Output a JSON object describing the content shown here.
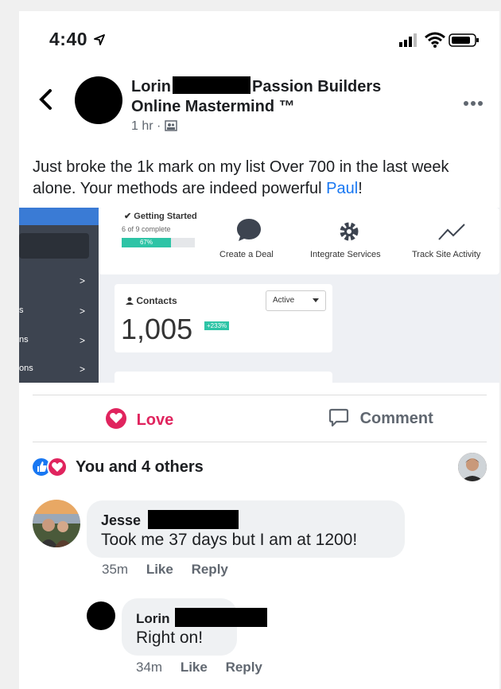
{
  "status": {
    "time": "4:40"
  },
  "post": {
    "author_first": "Lorin",
    "author_rest": "Passion Builders",
    "author_line2": "Online Mastermind ™",
    "time_ago": "1 hr",
    "text_before": "Just broke the 1k mark on my list Over 700 in the last week alone. Your methods are indeed powerful ",
    "text_link": "Paul",
    "text_after": "!"
  },
  "screenshot": {
    "getting_started": "✔ Getting Started",
    "progress_text": "6 of 9 complete",
    "progress_pct": "67%",
    "progress_value": 0.67,
    "actions": [
      "Create a Deal",
      "Integrate Services",
      "Track Site Activity"
    ],
    "contacts_label": "Contacts",
    "status_select": "Active",
    "contacts_count": "1,005",
    "growth": "+233%",
    "side_items": [
      {
        "label": "",
        "arrow": ">"
      },
      {
        "label": "s",
        "arrow": ">"
      },
      {
        "label": "ns",
        "arrow": ">"
      },
      {
        "label": "ons",
        "arrow": ">"
      }
    ]
  },
  "actions": {
    "love": "Love",
    "comment": "Comment"
  },
  "reactions": {
    "summary": "You and 4 others"
  },
  "comments": [
    {
      "name": "Jesse",
      "text": "Took me 37 days but I am at 1200!",
      "time": "35m",
      "like": "Like",
      "reply": "Reply"
    }
  ],
  "reply": {
    "name": "Lorin",
    "text": "Right on!",
    "time": "34m",
    "like": "Like",
    "reply": "Reply"
  },
  "colors": {
    "link": "#1877f2",
    "love": "#e0245e",
    "accent_green": "#2ec4a6"
  }
}
